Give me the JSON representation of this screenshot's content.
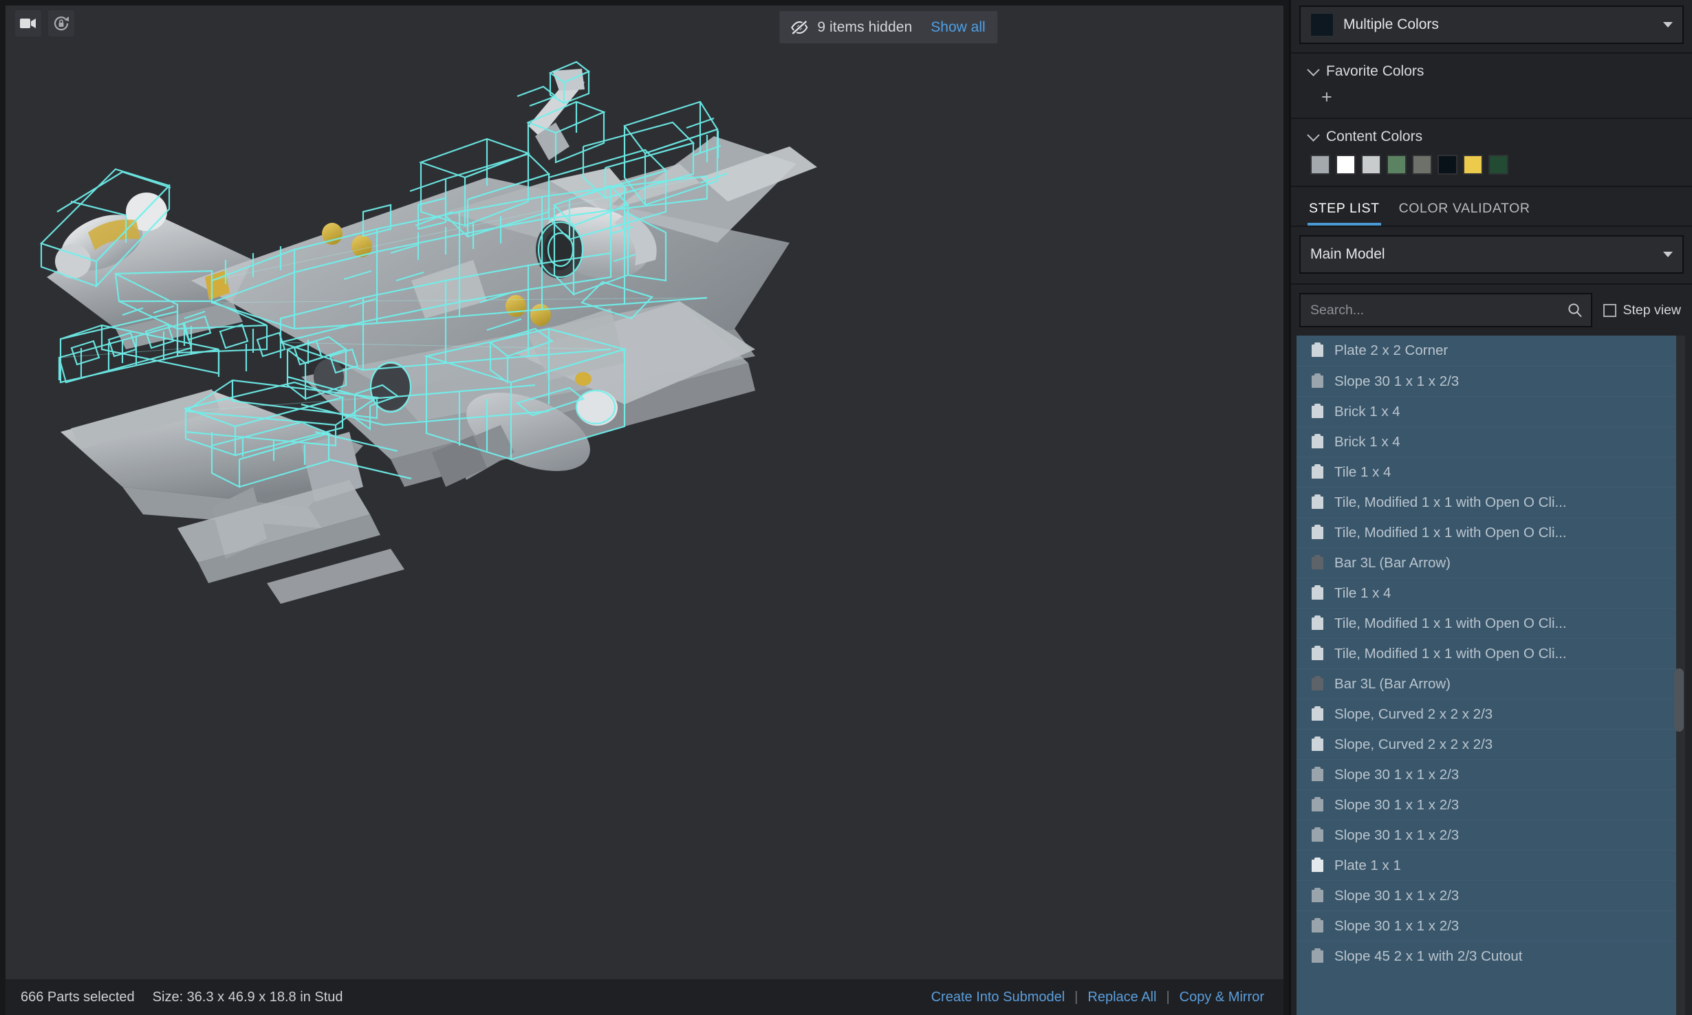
{
  "viewport": {
    "tools": [
      {
        "name": "camera-icon",
        "title": "Camera"
      },
      {
        "name": "lock-rotate-icon",
        "title": "Lock Rotation"
      }
    ],
    "hidden_notice": {
      "icon": "eye-off-icon",
      "text": "9 items hidden",
      "action_label": "Show all"
    },
    "background_color": "#2d2f33",
    "selection_color": "#6ff0ec",
    "model_description": "LEGO A-10 Thunderbolt aircraft wireframe selection"
  },
  "statusbar": {
    "parts_selected": "666 Parts selected",
    "size": "Size: 36.3 x 46.9 x 18.8 in Stud",
    "actions": [
      "Create Into Submodel",
      "Replace All",
      "Copy & Mirror"
    ],
    "separator": "|",
    "link_color": "#5b9fdd"
  },
  "panel": {
    "color_select": {
      "label": "Multiple Colors",
      "swatch_color": "#0e1820",
      "icon": "chevron-down-icon"
    },
    "favorite_colors": {
      "title": "Favorite Colors",
      "add_label": "+"
    },
    "content_colors": {
      "title": "Content Colors",
      "swatches": [
        "#a4a9ae",
        "#ffffff",
        "#c8cccd",
        "#5c8361",
        "#6e716a",
        "#0a1219",
        "#ecca4c",
        "#234a33"
      ]
    },
    "tabs": [
      {
        "label": "STEP LIST",
        "active": true
      },
      {
        "label": "COLOR VALIDATOR",
        "active": false
      }
    ],
    "model_select": {
      "label": "Main Model",
      "icon": "chevron-down-icon"
    },
    "search": {
      "placeholder": "Search...",
      "value": "",
      "icon": "search-icon"
    },
    "step_view": {
      "label": "Step view",
      "checked": false
    },
    "accent_color": "#4a9ad4",
    "list_selected_bg": "#3a566b",
    "parts": [
      {
        "name": "Plate 2 x 2 Corner",
        "tone": ""
      },
      {
        "name": "Slope 30 1 x 1 x 2/3",
        "tone": "dark"
      },
      {
        "name": "Brick 1 x 4",
        "tone": ""
      },
      {
        "name": "Brick 1 x 4",
        "tone": ""
      },
      {
        "name": "Tile 1 x 4",
        "tone": ""
      },
      {
        "name": "Tile, Modified 1 x 1 with Open O Cli...",
        "tone": ""
      },
      {
        "name": "Tile, Modified 1 x 1 with Open O Cli...",
        "tone": ""
      },
      {
        "name": "Bar   3L (Bar Arrow)",
        "tone": "darker"
      },
      {
        "name": "Tile 1 x 4",
        "tone": ""
      },
      {
        "name": "Tile, Modified 1 x 1 with Open O Cli...",
        "tone": ""
      },
      {
        "name": "Tile, Modified 1 x 1 with Open O Cli...",
        "tone": ""
      },
      {
        "name": "Bar   3L (Bar Arrow)",
        "tone": "darker"
      },
      {
        "name": "Slope, Curved 2 x 2 x 2/3",
        "tone": ""
      },
      {
        "name": "Slope, Curved 2 x 2 x 2/3",
        "tone": ""
      },
      {
        "name": "Slope 30 1 x 1 x 2/3",
        "tone": "dark"
      },
      {
        "name": "Slope 30 1 x 1 x 2/3",
        "tone": "dark"
      },
      {
        "name": "Slope 30 1 x 1 x 2/3",
        "tone": "dark"
      },
      {
        "name": "Plate 1 x 1",
        "tone": "bright"
      },
      {
        "name": "Slope 30 1 x 1 x 2/3",
        "tone": "dark"
      },
      {
        "name": "Slope 30 1 x 1 x 2/3",
        "tone": "dark"
      },
      {
        "name": "Slope 45 2 x 1 with 2/3 Cutout",
        "tone": "dark"
      }
    ]
  }
}
